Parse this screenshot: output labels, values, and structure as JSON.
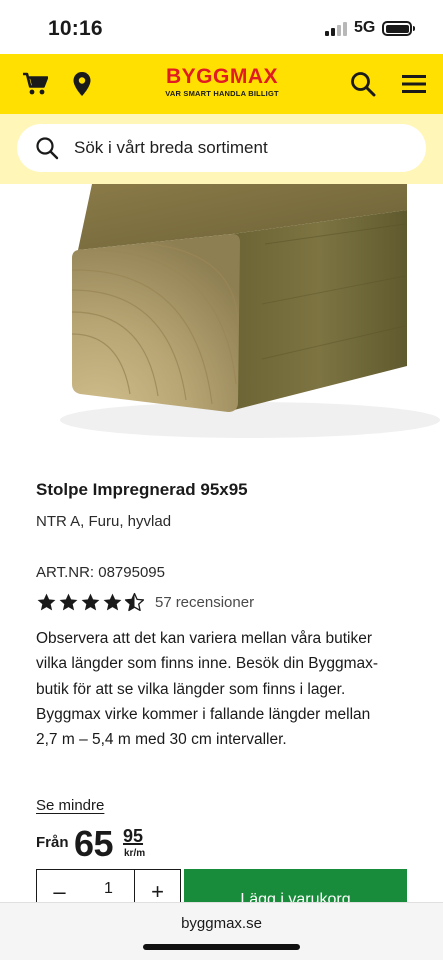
{
  "status_bar": {
    "time": "10:16",
    "network": "5G"
  },
  "header": {
    "brand": "BYGGMAX",
    "tagline": "VAR SMART HANDLA BILLIGT",
    "brand_color": "#e11b22",
    "background_color": "#ffe000",
    "left_icons": [
      "cart-icon",
      "location-pin-icon"
    ],
    "right_icons": [
      "search-icon",
      "menu-icon"
    ]
  },
  "search": {
    "placeholder": "Sök i vårt breda sortiment",
    "band_color": "#fff6b8"
  },
  "product": {
    "title": "Stolpe Impregnerad 95x95",
    "subtitle": "NTR A, Furu, hyvlad",
    "art_label": "ART.NR:",
    "art_number": "08795095",
    "rating": 4.5,
    "rating_max": 5,
    "review_count": "57",
    "review_label": "recensioner",
    "description": "Observera att det kan variera mellan våra butiker vilka längder som finns inne. Besök din Byggmax-butik för att se vilka längder som finns i lager. Byggmax virke kommer i fallande längder mellan 2,7 m – 5,4 m med 30 cm intervaller.",
    "toggle_link": "Se mindre"
  },
  "price": {
    "prefix": "Från",
    "integer": "65",
    "decimals": "95",
    "unit": "kr/m"
  },
  "purchase": {
    "minus": "–",
    "quantity": "1",
    "plus": "+",
    "add_to_cart": "Lägg i varukorg",
    "button_color": "#198c3b"
  },
  "browser": {
    "url": "byggmax.se"
  }
}
